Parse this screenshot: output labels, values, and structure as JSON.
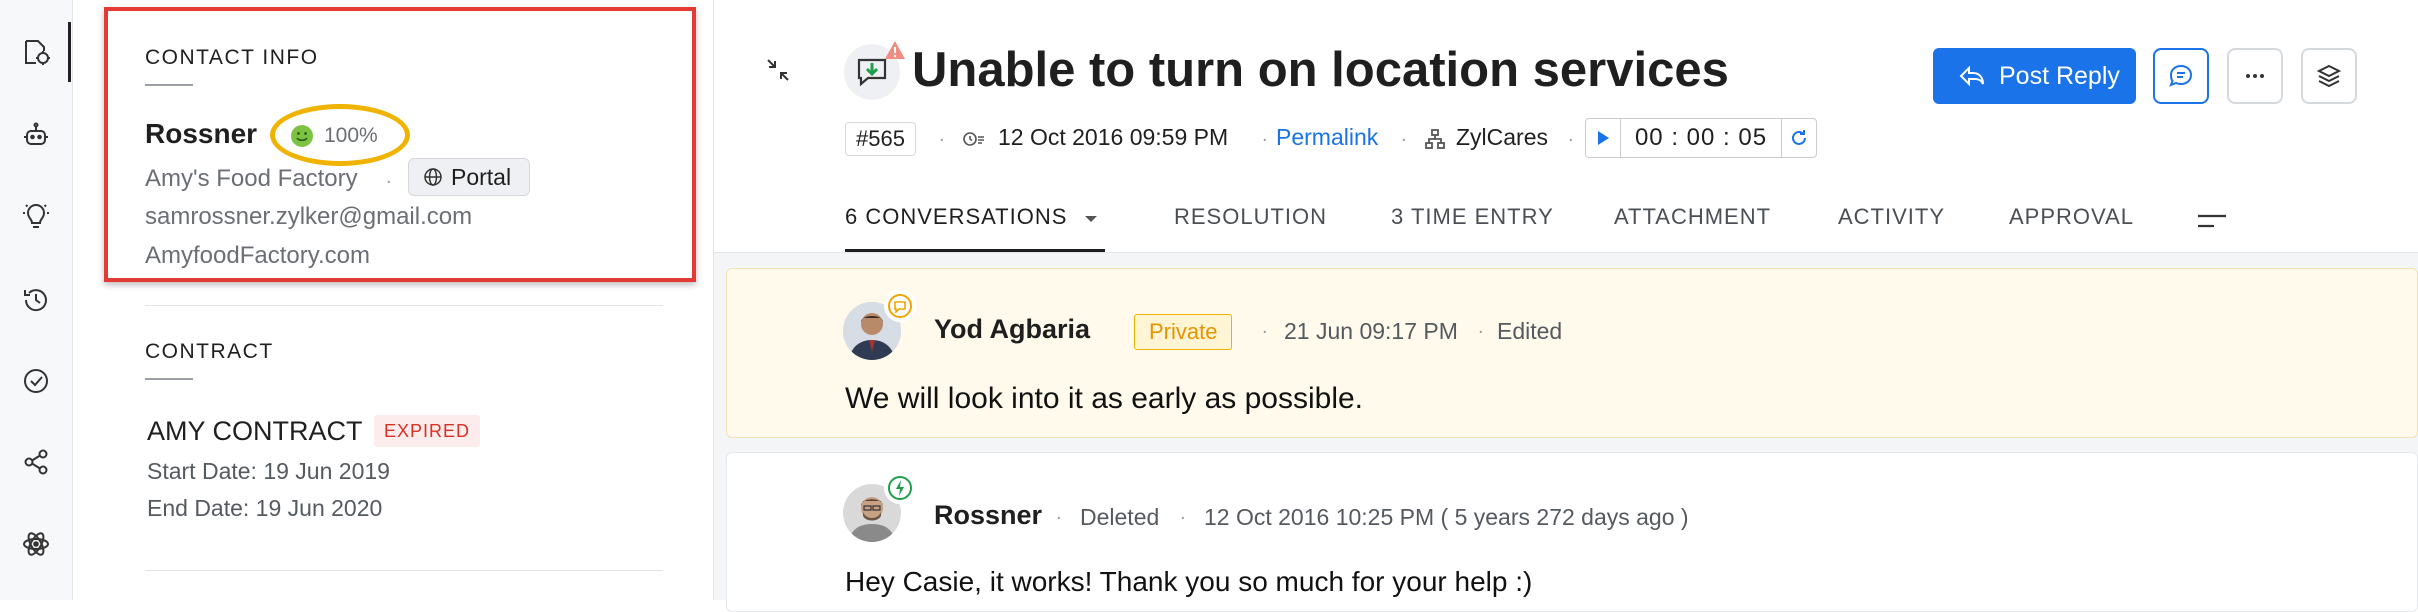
{
  "contact": {
    "section_title": "CONTACT INFO",
    "name": "Rossner",
    "happiness": "100%",
    "account": "Amy's Food Factory",
    "channel": "Portal",
    "email": "samrossner.zylker@gmail.com",
    "website": "AmyfoodFactory.com"
  },
  "contract": {
    "section_title": "CONTRACT",
    "name": "AMY CONTRACT",
    "status": "EXPIRED",
    "start_date": "Start Date:  19 Jun 2019",
    "end_date": "End Date:  19 Jun 2020"
  },
  "ticket": {
    "title": "Unable to turn on location services",
    "id": "#565",
    "created": "12 Oct 2016 09:59 PM",
    "permalink": "Permalink",
    "department": "ZylCares",
    "timer": "00 : 00 : 05",
    "post_reply": "Post Reply"
  },
  "tabs": [
    {
      "label": "6 CONVERSATIONS"
    },
    {
      "label": "RESOLUTION"
    },
    {
      "label": "3 TIME ENTRY"
    },
    {
      "label": "ATTACHMENT"
    },
    {
      "label": "ACTIVITY"
    },
    {
      "label": "APPROVAL"
    }
  ],
  "conversations": [
    {
      "author": "Yod Agbaria",
      "tag": "Private",
      "time": "21 Jun 09:17 PM",
      "note": "Edited",
      "body": "We will look into it as early as possible."
    },
    {
      "author": "Rossner",
      "status": "Deleted",
      "time": "12 Oct 2016 10:25 PM ( 5 years 272 days ago )",
      "body": "Hey Casie, it works! Thank you so much for your help :)"
    }
  ],
  "colors": {
    "accent": "#1a73e8",
    "highlight_box": "#e53935",
    "happiness_ring": "#f0b400",
    "private_bg": "#fffaec",
    "expired": "#d93025"
  },
  "icons": [
    "ticket-info-icon",
    "bot-icon",
    "idea-icon",
    "history-icon",
    "check-circle-icon",
    "share-icon",
    "atom-icon"
  ]
}
